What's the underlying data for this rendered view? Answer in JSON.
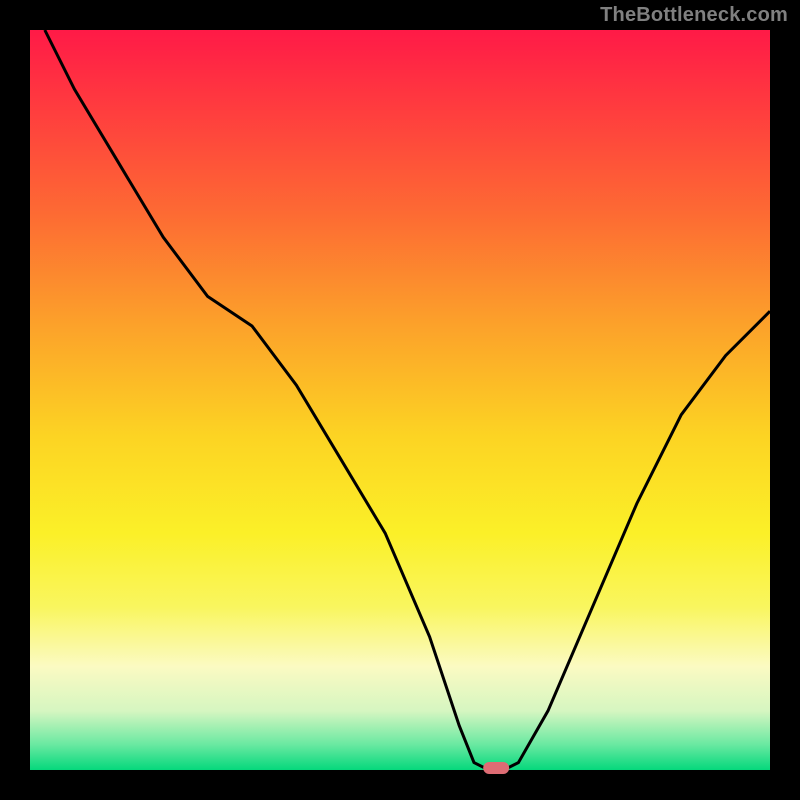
{
  "watermark": "TheBottleneck.com",
  "chart_data": {
    "type": "line",
    "title": "",
    "xlabel": "",
    "ylabel": "",
    "xlim": [
      0,
      100
    ],
    "ylim": [
      0,
      100
    ],
    "series": [
      {
        "name": "bottleneck-curve",
        "x": [
          2,
          6,
          12,
          18,
          24,
          30,
          36,
          42,
          48,
          54,
          58,
          60,
          62,
          64,
          66,
          70,
          76,
          82,
          88,
          94,
          100
        ],
        "values": [
          100,
          92,
          82,
          72,
          64,
          60,
          52,
          42,
          32,
          18,
          6,
          1,
          0,
          0,
          1,
          8,
          22,
          36,
          48,
          56,
          62
        ]
      }
    ],
    "marker": {
      "x": 63,
      "y": 0,
      "color": "#de6c74"
    },
    "gradient_stops": [
      {
        "offset": 0.0,
        "color": "#ff1a47"
      },
      {
        "offset": 0.1,
        "color": "#ff3a3f"
      },
      {
        "offset": 0.25,
        "color": "#fd6b33"
      },
      {
        "offset": 0.4,
        "color": "#fca22a"
      },
      {
        "offset": 0.55,
        "color": "#fcd423"
      },
      {
        "offset": 0.68,
        "color": "#fbf028"
      },
      {
        "offset": 0.78,
        "color": "#f9f65f"
      },
      {
        "offset": 0.86,
        "color": "#fbfac2"
      },
      {
        "offset": 0.92,
        "color": "#d6f6c1"
      },
      {
        "offset": 0.965,
        "color": "#6be9a2"
      },
      {
        "offset": 1.0,
        "color": "#05d87c"
      }
    ],
    "plot_background": "#000000",
    "frame_color": "#000000",
    "curve_color": "#000000"
  },
  "layout": {
    "outer_w": 800,
    "outer_h": 800,
    "inner_x": 30,
    "inner_y": 30,
    "inner_w": 740,
    "inner_h": 740
  }
}
